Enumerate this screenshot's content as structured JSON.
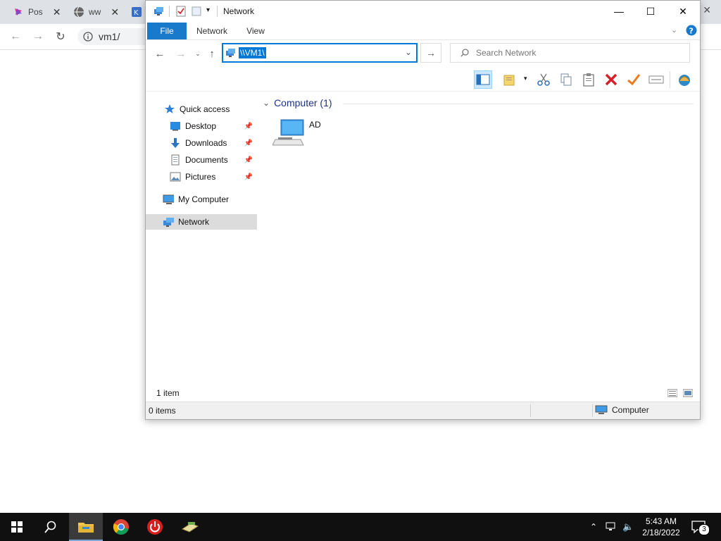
{
  "browser": {
    "tabs": [
      {
        "label": "Pos"
      },
      {
        "label": "ww"
      }
    ],
    "address": "vm1/"
  },
  "window": {
    "title": "Network",
    "ribbon_tabs": [
      "File",
      "Network",
      "View"
    ],
    "address_value": "\\\\VM1\\",
    "search_placeholder": "Search Network",
    "nav": {
      "quick_access": "Quick access",
      "desktop": "Desktop",
      "downloads": "Downloads",
      "documents": "Documents",
      "pictures": "Pictures",
      "my_computer": "My Computer",
      "network": "Network"
    },
    "group_header": "Computer (1)",
    "items": [
      {
        "label": "AD"
      }
    ],
    "item_count": "1 item",
    "status": {
      "selected": "0 items",
      "zone": "Computer"
    }
  },
  "taskbar": {
    "time": "5:43 AM",
    "date": "2/18/2022",
    "notification_count": "3"
  }
}
